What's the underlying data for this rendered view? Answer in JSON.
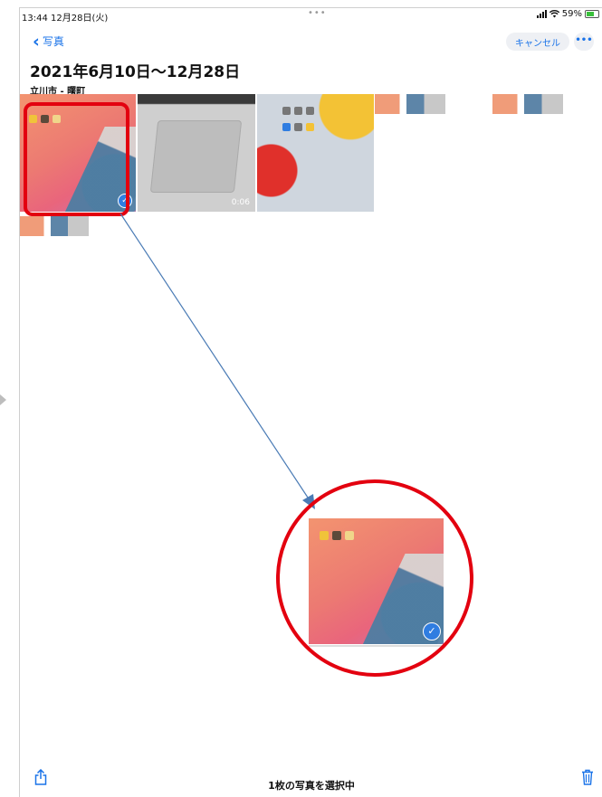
{
  "status_bar": {
    "time_date": "13:44 12月28日(火)",
    "center": "•••",
    "battery_percent": "59%",
    "battery_level": 0.59
  },
  "nav": {
    "back_label": "写真",
    "cancel_label": "キャンセル",
    "more_label": "•••"
  },
  "header": {
    "title": "2021年6月10日〜12月28日",
    "location": "立川市 - 曙町"
  },
  "grid": {
    "items": [
      {
        "type": "photo",
        "selected": true
      },
      {
        "type": "video",
        "duration": "0:06"
      },
      {
        "type": "photo"
      },
      {
        "type": "photo"
      },
      {
        "type": "photo"
      },
      {
        "type": "photo"
      }
    ]
  },
  "toolbar": {
    "selection_label": "1枚の写真を選択中"
  },
  "colors": {
    "accent": "#1a73e8",
    "highlight": "#e3000f",
    "check": "#2f7de1"
  },
  "icons": [
    "chevron-left-icon",
    "share-icon",
    "trash-icon",
    "wifi-icon",
    "signal-icon",
    "battery-icon",
    "checkmark-icon"
  ]
}
